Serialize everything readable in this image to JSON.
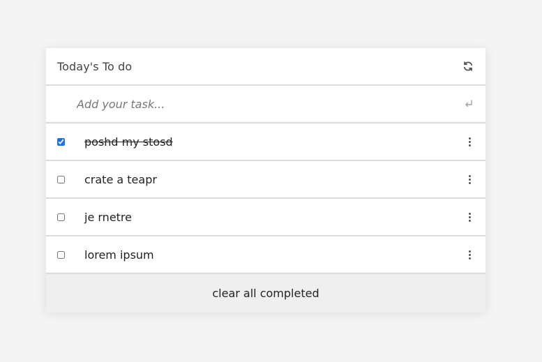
{
  "header": {
    "title": "Today's To do",
    "refresh_icon": "refresh-icon"
  },
  "add_task": {
    "placeholder": "Add your task...",
    "value": "",
    "enter_icon": "enter-icon"
  },
  "tasks": [
    {
      "text": "poshd my stosd",
      "completed": true
    },
    {
      "text": "crate a teapr",
      "completed": false
    },
    {
      "text": "je rnetre",
      "completed": false
    },
    {
      "text": "lorem ipsum",
      "completed": false
    }
  ],
  "footer": {
    "clear_label": "clear all completed"
  },
  "colors": {
    "background": "#f4f4f4",
    "card": "#ffffff",
    "footer": "#efefef",
    "checkbox_accent": "#1a73e8"
  }
}
